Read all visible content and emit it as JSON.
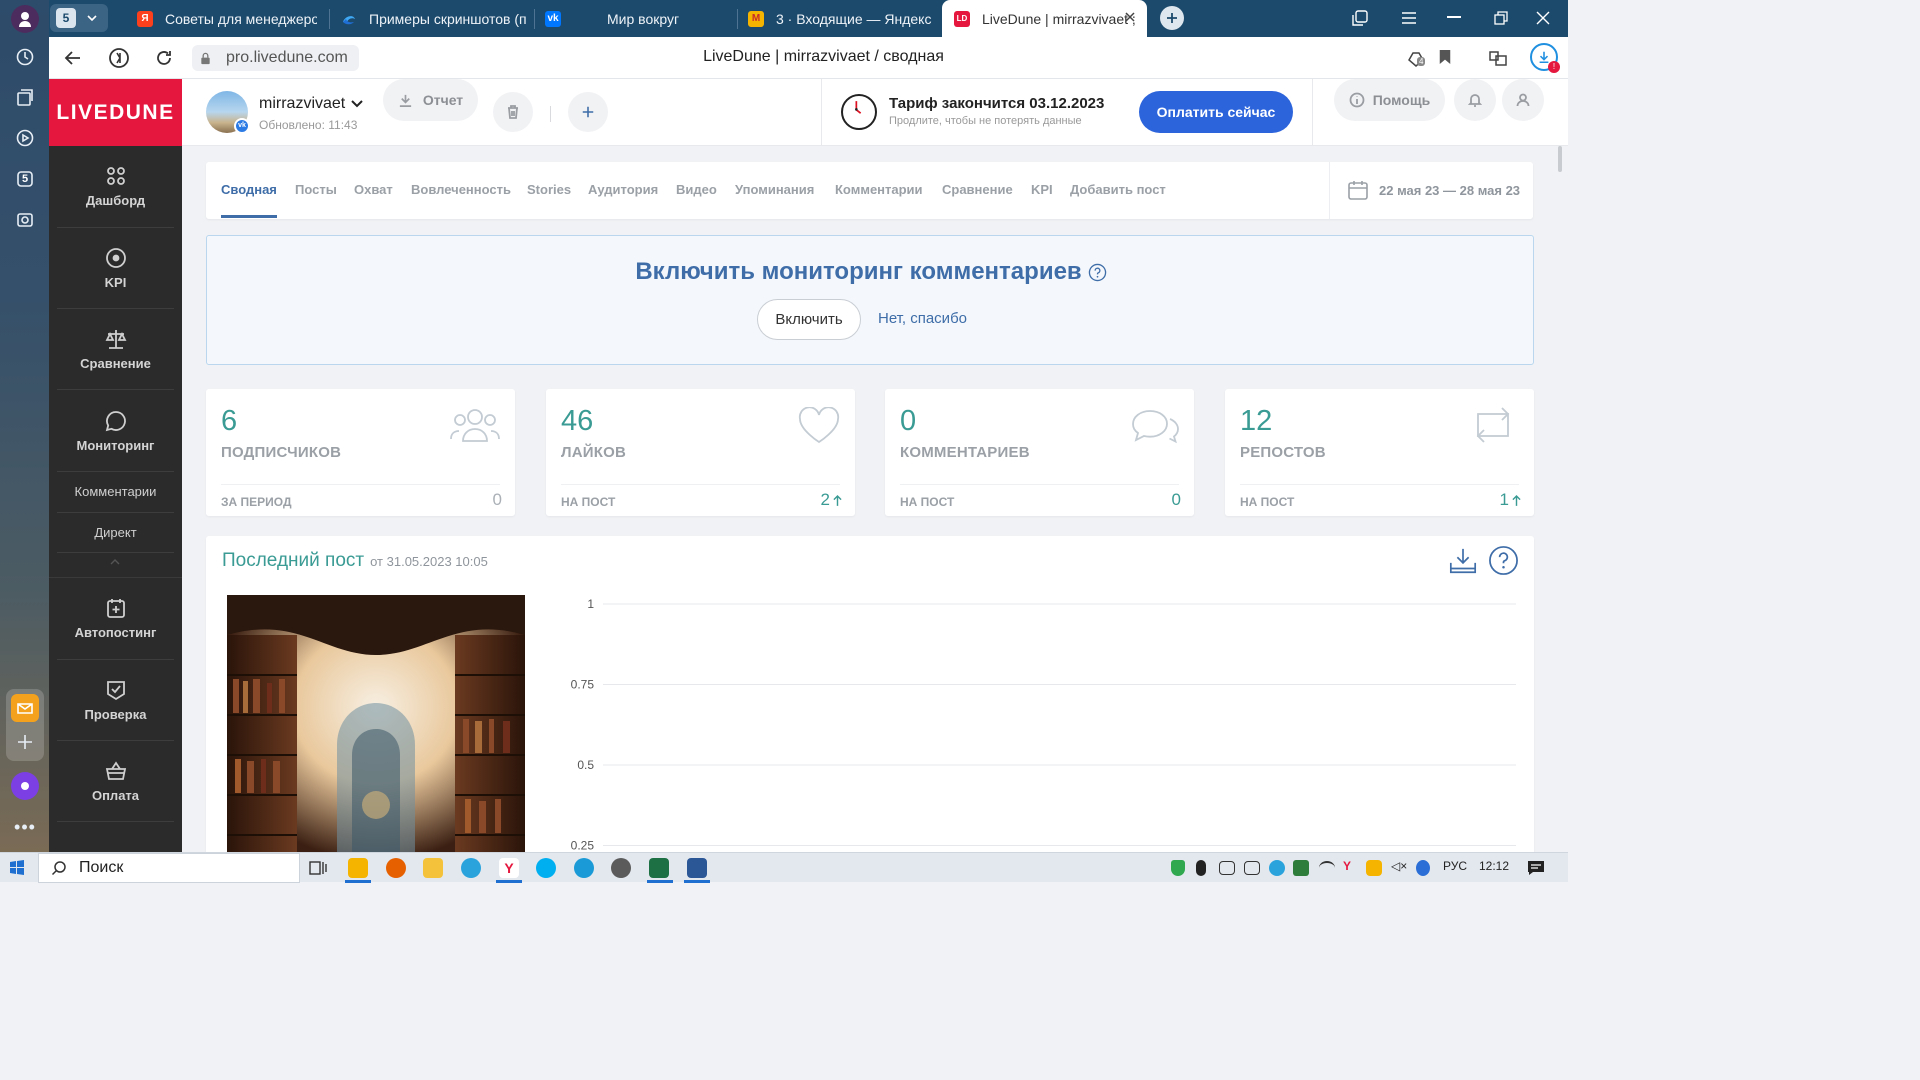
{
  "browser": {
    "panel_badge": "5",
    "tabs": [
      {
        "title": "Советы для менеджеров",
        "icon": "yandex-icon",
        "color": "#fc3f1d"
      },
      {
        "title": "Примеры скриншотов (по",
        "icon": "edge-icon",
        "color": "#2b6fd6"
      },
      {
        "title": "Мир вокруг",
        "icon": "vk-icon",
        "color": "#0077ff"
      },
      {
        "title": "3 · Входящие — Яндекс По",
        "icon": "mail-icon",
        "color": "#f5b400"
      },
      {
        "title": "LiveDune | mirrazvivaet ;",
        "icon": "livedune-icon",
        "color": "#e5173f"
      }
    ],
    "address": "pro.livedune.com",
    "page_title": "LiveDune | mirrazvivaet / сводная",
    "badge_count": "4"
  },
  "brand": "LIVEDUNE",
  "sidebar": {
    "items": [
      {
        "label": "Дашборд",
        "icon": "dashboard-icon"
      },
      {
        "label": "KPI",
        "icon": "target-icon"
      },
      {
        "label": "Сравнение",
        "icon": "scales-icon"
      },
      {
        "label": "Мониторинг",
        "icon": "chat-bubble-icon"
      },
      {
        "label": "Автопостинг",
        "icon": "calendar-plus-icon"
      },
      {
        "label": "Проверка",
        "icon": "shield-check-icon"
      },
      {
        "label": "Оплата",
        "icon": "basket-icon"
      }
    ],
    "sub_items": [
      "Комментарии",
      "Директ"
    ]
  },
  "header": {
    "account_name": "mirrazvivaet",
    "updated": "Обновлено: 11:43",
    "report_label": "Отчет",
    "tariff_title": "Тариф закончится 03.12.2023",
    "tariff_sub": "Продлите, чтобы не потерять данные",
    "pay_label": "Оплатить сейчас",
    "help_label": "Помощь"
  },
  "tabs": [
    "Сводная",
    "Посты",
    "Охват",
    "Вовлеченность",
    "Stories",
    "Аудитория",
    "Видео",
    "Упоминания",
    "Комментарии",
    "Сравнение",
    "KPI",
    "Добавить пост"
  ],
  "date_range": "22 мая 23 — 28 мая 23",
  "monitoring": {
    "title": "Включить мониторинг комментариев",
    "enable_label": "Включить",
    "decline_label": "Нет, спасибо"
  },
  "stats": [
    {
      "value": "6",
      "label": "ПОДПИСЧИКОВ",
      "sub": "ЗА ПЕРИОД",
      "delta": "0",
      "arrow": false,
      "icon": "people-icon"
    },
    {
      "value": "46",
      "label": "ЛАЙКОВ",
      "sub": "НА ПОСТ",
      "delta": "2",
      "arrow": true,
      "icon": "heart-icon"
    },
    {
      "value": "0",
      "label": "КОММЕНТАРИЕВ",
      "sub": "НА ПОСТ",
      "delta": "0",
      "arrow": false,
      "icon": "comments-icon"
    },
    {
      "value": "12",
      "label": "РЕПОСТОВ",
      "sub": "НА ПОСТ",
      "delta": "1",
      "arrow": true,
      "icon": "repost-icon"
    }
  ],
  "last_post": {
    "title": "Последний пост",
    "date": "от 31.05.2023 10:05"
  },
  "chart_data": {
    "type": "line",
    "y_ticks": [
      "1",
      "0.75",
      "0.5",
      "0.25"
    ],
    "ylim": [
      0,
      1
    ],
    "grid": true,
    "series": []
  },
  "taskbar": {
    "search": "Поиск",
    "lang": "РУС",
    "time": "12:12"
  }
}
